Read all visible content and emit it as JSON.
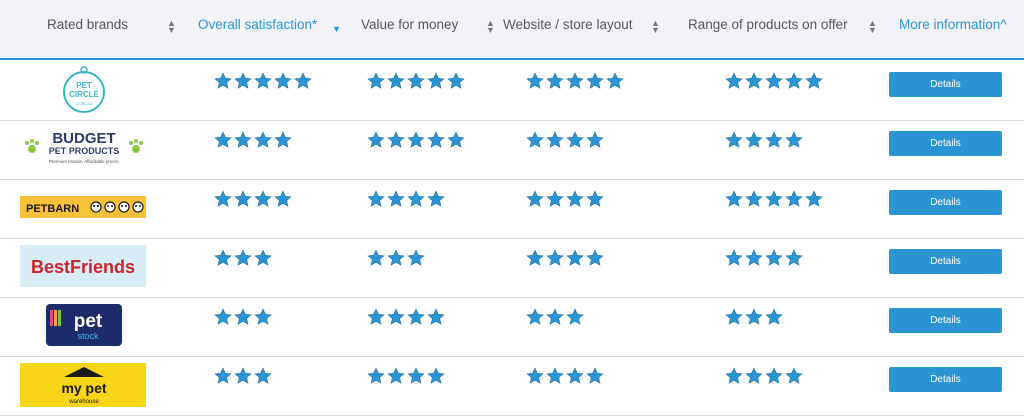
{
  "header": {
    "col_brand": "Rated brands",
    "col_overall": "Overall satisfaction*",
    "col_value": "Value for money",
    "col_layout": "Website / store layout",
    "col_range": "Range of products on offer",
    "col_more": "More information^"
  },
  "colors": {
    "accent": "#2b95d3",
    "star": "#2b95d3",
    "header_bg": "#f2f3f7"
  },
  "rows": [
    {
      "brand": "Pet Circle",
      "logo_text": [
        "PET",
        "CIRCLE",
        ".COM.AU"
      ],
      "overall": 5,
      "value": 5,
      "layout": 5,
      "range": 5,
      "button": "Details"
    },
    {
      "brand": "Budget Pet Products",
      "logo_text": [
        "BUDGET",
        "PET PRODUCTS",
        "Premium brands. Affordable prices."
      ],
      "overall": 4,
      "value": 5,
      "layout": 4,
      "range": 4,
      "button": "Details"
    },
    {
      "brand": "Petbarn",
      "logo_text": [
        "PETBARN"
      ],
      "overall": 4,
      "value": 4,
      "layout": 4,
      "range": 5,
      "button": "Details"
    },
    {
      "brand": "Best Friends",
      "logo_text": [
        "BestFriends"
      ],
      "overall": 3,
      "value": 3,
      "layout": 4,
      "range": 4,
      "button": "Details"
    },
    {
      "brand": "Pet Stock",
      "logo_text": [
        "pet",
        "stock"
      ],
      "overall": 3,
      "value": 4,
      "layout": 3,
      "range": 3,
      "button": "Details"
    },
    {
      "brand": "My Pet Warehouse",
      "logo_text": [
        "my pet",
        "warehouse"
      ],
      "overall": 3,
      "value": 4,
      "layout": 4,
      "range": 4,
      "button": "Details"
    }
  ]
}
